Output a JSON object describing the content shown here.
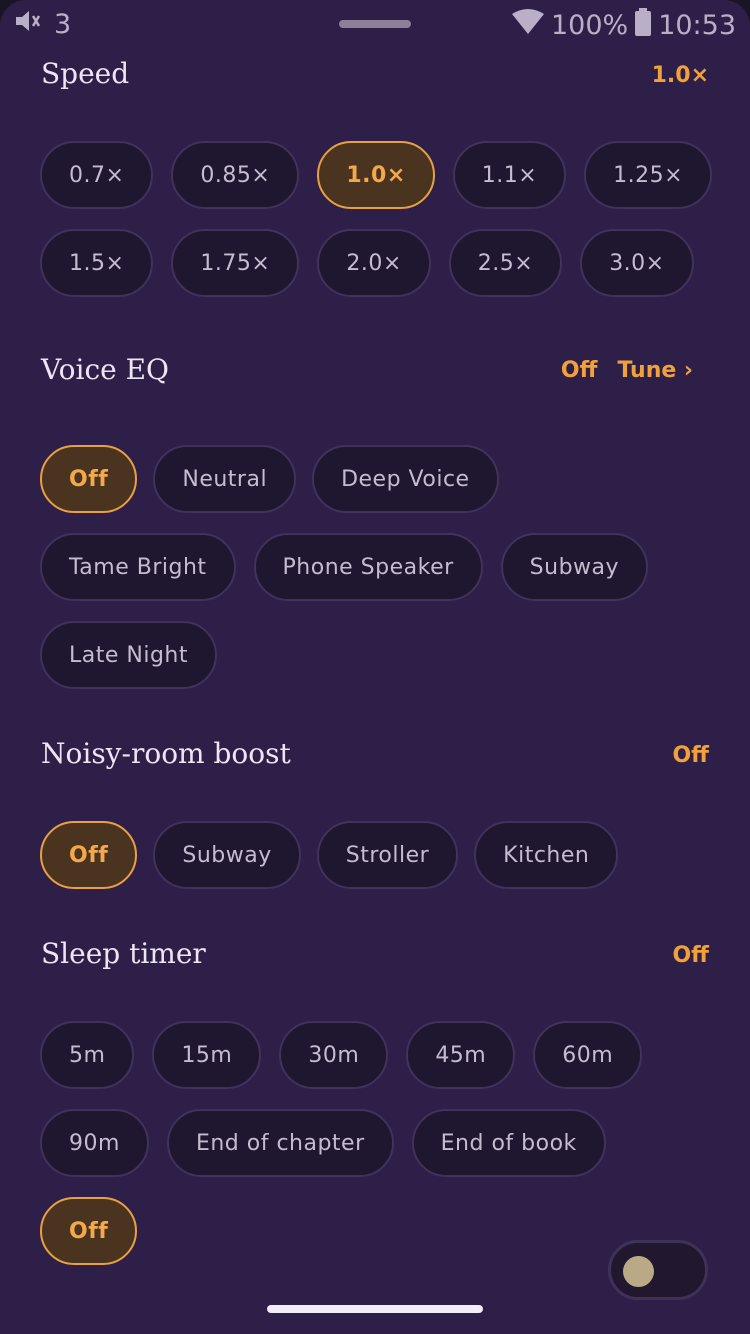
{
  "status": {
    "notifications": "3",
    "battery": "100%",
    "time": "10:53"
  },
  "speed": {
    "title": "Speed",
    "value": "1.0×",
    "options": [
      "0.7×",
      "0.85×",
      "1.0×",
      "1.1×",
      "1.25×",
      "1.5×",
      "1.75×",
      "2.0×",
      "2.5×",
      "3.0×"
    ],
    "selected": "1.0×"
  },
  "voice_eq": {
    "title": "Voice EQ",
    "value": "Off",
    "tune_label": "Tune ›",
    "options": [
      "Off",
      "Neutral",
      "Deep Voice",
      "Tame Bright",
      "Phone Speaker",
      "Subway",
      "Late Night"
    ],
    "selected": "Off"
  },
  "noisy_boost": {
    "title": "Noisy-room boost",
    "value": "Off",
    "options": [
      "Off",
      "Subway",
      "Stroller",
      "Kitchen"
    ],
    "selected": "Off"
  },
  "sleep_timer": {
    "title": "Sleep timer",
    "value": "Off",
    "options": [
      "5m",
      "15m",
      "30m",
      "45m",
      "60m",
      "90m",
      "End of chapter",
      "End of book",
      "Off"
    ],
    "selected": "Off"
  },
  "toggle": {
    "on": false
  },
  "colors": {
    "accent": "#f0a13a",
    "background": "#2e1f49",
    "chip": "#1f1630"
  }
}
